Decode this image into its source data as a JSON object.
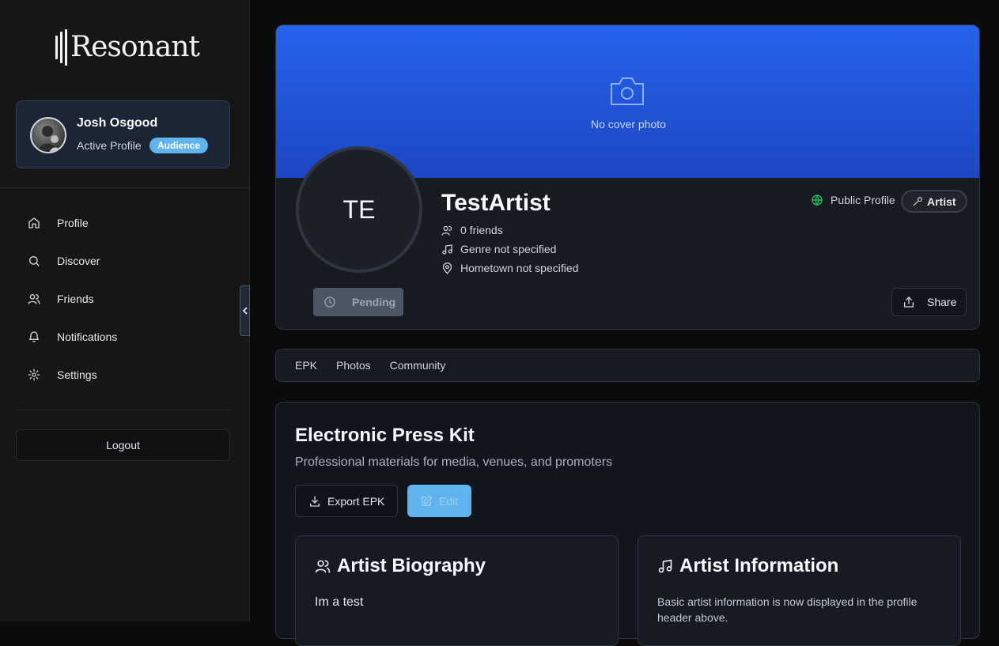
{
  "app": {
    "name": "Resonant"
  },
  "sidebar": {
    "user": {
      "name": "Josh Osgood",
      "status": "Active Profile",
      "badge": "Audience"
    },
    "nav": [
      {
        "label": "Profile",
        "icon": "home-icon"
      },
      {
        "label": "Discover",
        "icon": "search-icon"
      },
      {
        "label": "Friends",
        "icon": "users-icon"
      },
      {
        "label": "Notifications",
        "icon": "bell-icon"
      },
      {
        "label": "Settings",
        "icon": "gear-icon"
      }
    ],
    "logout_label": "Logout"
  },
  "profile": {
    "cover_text": "No cover photo",
    "initials": "TE",
    "name": "TestArtist",
    "friends": "0 friends",
    "genre": "Genre not specified",
    "hometown": "Hometown not specified",
    "visibility": "Public Profile",
    "type_badge": "Artist",
    "pending_label": "Pending",
    "share_label": "Share"
  },
  "tabs": [
    "EPK",
    "Photos",
    "Community"
  ],
  "epk": {
    "title": "Electronic Press Kit",
    "subtitle": "Professional materials for media, venues, and promoters",
    "export_label": "Export EPK",
    "edit_label": "Edit",
    "bio_card": {
      "title": "Artist Biography",
      "text": "Im a test"
    },
    "info_card": {
      "title": "Artist Information",
      "text": "Basic artist information is now displayed in the profile header above."
    }
  },
  "colors": {
    "accent": "#60b4ee",
    "cover": "#2563eb",
    "public": "#22c55e"
  }
}
